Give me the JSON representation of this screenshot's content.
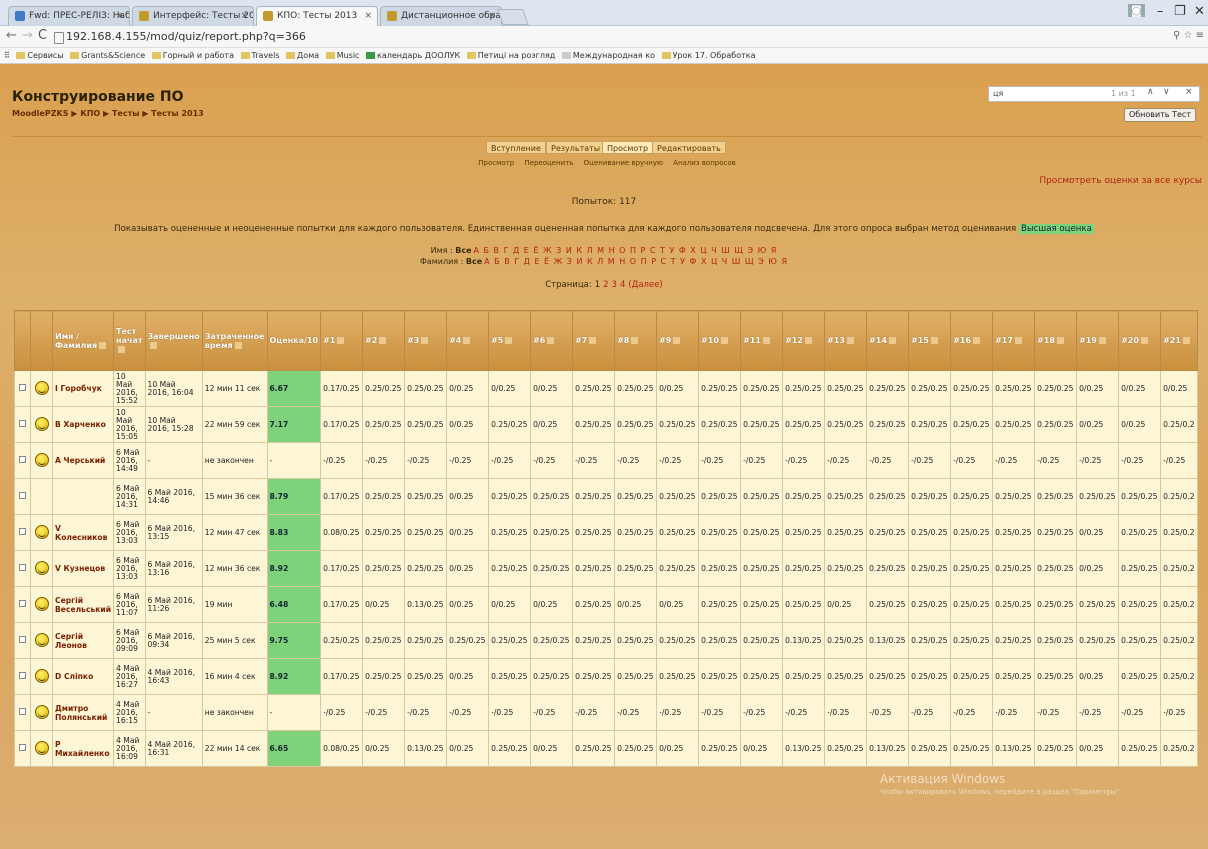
{
  "browser": {
    "tabs": [
      {
        "label": "Fwd: ПРЕС-РЕЛІЗ: Набо"
      },
      {
        "label": "Интерфейс: Тесты 2013"
      },
      {
        "label": "КПО: Тесты 2013"
      },
      {
        "label": "Дистанционное образо"
      }
    ],
    "url": "192.168.4.155/mod/quiz/report.php?q=366",
    "bookmarks": [
      "Сервисы",
      "Grants&Science",
      "Горный и работа",
      "Travels",
      "Дома",
      "Music",
      "календарь ДООЛУК",
      "Петиці на розгляд",
      "Международная ко",
      "Урок 17. Обработка"
    ]
  },
  "find": {
    "query": "ця",
    "count": "1 из 1"
  },
  "course": {
    "title": "Конструирование ПО",
    "breadcrumb": "MoodlePZKS ▶ КПО ▶ Тесты ▶ Тесты 2013",
    "refresh_label": "Обновить Тест"
  },
  "tabs": {
    "main": [
      "Вступление",
      "Результаты",
      "Просмотр",
      "Редактировать"
    ],
    "sub": [
      "Просмотр",
      "Переоценить",
      "Оценивание вручную",
      "Анализ вопросов"
    ]
  },
  "report": {
    "all_grades_link": "Просмотреть оценки за все курсы",
    "attempts": "Попыток: 117",
    "description": "Показывать оцененные и неоцененные попытки для каждого пользователя. Единственная оцененная попытка для каждого пользователя подсвечена. Для этого опроса выбран метод оценивания",
    "method": "Высшая оценка",
    "firstname_label": "Имя :",
    "lastname_label": "Фамилия :",
    "all_label": "Все",
    "letters": "А Б В Г Д Е Ё Ж З И К Л М Н О П Р С Т У Ф Х Ц Ч Ш Щ Э Ю Я",
    "pages_label": "Страница:",
    "pages": [
      "1",
      "2",
      "3",
      "4",
      "(Далее)"
    ]
  },
  "columns": [
    "",
    "",
    "Имя / Фамилия",
    "Тест начат",
    "Завершено",
    "Затраченное время",
    "Оценка/10",
    "#1",
    "#2",
    "#3",
    "#4",
    "#5",
    "#6",
    "#7",
    "#8",
    "#9",
    "#10",
    "#11",
    "#12",
    "#13",
    "#14",
    "#15",
    "#16",
    "#17",
    "#18",
    "#19",
    "#20",
    "#21"
  ],
  "rows": [
    {
      "name": "І Горобчук",
      "started": "10 Май 2016, 15:52",
      "finished": "10 Май 2016, 16:04",
      "time": "12 мин 11 сек",
      "grade": "6.67",
      "q": [
        "0.17/0.25",
        "0.25/0.25",
        "0.25/0.25",
        "0/0.25",
        "0/0.25",
        "0/0.25",
        "0.25/0.25",
        "0.25/0.25",
        "0/0.25",
        "0.25/0.25",
        "0.25/0.25",
        "0.25/0.25",
        "0.25/0.25",
        "0.25/0.25",
        "0.25/0.25",
        "0.25/0.25",
        "0.25/0.25",
        "0.25/0.25",
        "0/0.25",
        "0/0.25",
        "0/0.25"
      ]
    },
    {
      "name": "В Харченко",
      "started": "10 Май 2016, 15:05",
      "finished": "10 Май 2016, 15:28",
      "time": "22 мин 59 сек",
      "grade": "7.17",
      "q": [
        "0.17/0.25",
        "0.25/0.25",
        "0.25/0.25",
        "0/0.25",
        "0.25/0.25",
        "0/0.25",
        "0.25/0.25",
        "0.25/0.25",
        "0.25/0.25",
        "0.25/0.25",
        "0.25/0.25",
        "0.25/0.25",
        "0.25/0.25",
        "0.25/0.25",
        "0.25/0.25",
        "0.25/0.25",
        "0.25/0.25",
        "0.25/0.25",
        "0/0.25",
        "0/0.25",
        "0.25/0.2"
      ]
    },
    {
      "name": "А Черський",
      "started": "6 Май 2016, 14:49",
      "finished": "-",
      "time": "не закончен",
      "grade": "-",
      "q": [
        "-/0.25",
        "-/0.25",
        "-/0.25",
        "-/0.25",
        "-/0.25",
        "-/0.25",
        "-/0.25",
        "-/0.25",
        "-/0.25",
        "-/0.25",
        "-/0.25",
        "-/0.25",
        "-/0.25",
        "-/0.25",
        "-/0.25",
        "-/0.25",
        "-/0.25",
        "-/0.25",
        "-/0.25",
        "-/0.25",
        "-/0.25"
      ]
    },
    {
      "name": "",
      "started": "6 Май 2016, 14:31",
      "finished": "6 Май 2016, 14:46",
      "time": "15 мин 36 сек",
      "grade": "8.79",
      "q": [
        "0.17/0.25",
        "0.25/0.25",
        "0.25/0.25",
        "0/0.25",
        "0.25/0.25",
        "0.25/0.25",
        "0.25/0.25",
        "0.25/0.25",
        "0.25/0.25",
        "0.25/0.25",
        "0.25/0.25",
        "0.25/0.25",
        "0.25/0.25",
        "0.25/0.25",
        "0.25/0.25",
        "0.25/0.25",
        "0.25/0.25",
        "0.25/0.25",
        "0.25/0.25",
        "0.25/0.25",
        "0.25/0.2"
      ]
    },
    {
      "name": "V Колесников",
      "started": "6 Май 2016, 13:03",
      "finished": "6 Май 2016, 13:15",
      "time": "12 мин 47 сек",
      "grade": "8.83",
      "q": [
        "0.08/0.25",
        "0.25/0.25",
        "0.25/0.25",
        "0/0.25",
        "0.25/0.25",
        "0.25/0.25",
        "0.25/0.25",
        "0.25/0.25",
        "0.25/0.25",
        "0.25/0.25",
        "0.25/0.25",
        "0.25/0.25",
        "0.25/0.25",
        "0.25/0.25",
        "0.25/0.25",
        "0.25/0.25",
        "0.25/0.25",
        "0.25/0.25",
        "0/0.25",
        "0.25/0.25",
        "0.25/0.2"
      ]
    },
    {
      "name": "V Кузнецов",
      "started": "6 Май 2016, 13:03",
      "finished": "6 Май 2016, 13:16",
      "time": "12 мин 36 сек",
      "grade": "8.92",
      "q": [
        "0.17/0.25",
        "0.25/0.25",
        "0.25/0.25",
        "0/0.25",
        "0.25/0.25",
        "0.25/0.25",
        "0.25/0.25",
        "0.25/0.25",
        "0.25/0.25",
        "0.25/0.25",
        "0.25/0.25",
        "0.25/0.25",
        "0.25/0.25",
        "0.25/0.25",
        "0.25/0.25",
        "0.25/0.25",
        "0.25/0.25",
        "0.25/0.25",
        "0/0.25",
        "0.25/0.25",
        "0.25/0.2"
      ]
    },
    {
      "name": "Сергій Весельський",
      "started": "6 Май 2016, 11:07",
      "finished": "6 Май 2016, 11:26",
      "time": "19 мин",
      "grade": "6.48",
      "q": [
        "0.17/0.25",
        "0/0.25",
        "0.13/0.25",
        "0/0.25",
        "0/0.25",
        "0/0.25",
        "0.25/0.25",
        "0/0.25",
        "0/0.25",
        "0.25/0.25",
        "0.25/0.25",
        "0.25/0.25",
        "0/0.25",
        "0.25/0.25",
        "0.25/0.25",
        "0.25/0.25",
        "0.25/0.25",
        "0.25/0.25",
        "0.25/0.25",
        "0.25/0.25",
        "0.25/0.2"
      ]
    },
    {
      "name": "Сергій Леонов",
      "started": "6 Май 2016, 09:09",
      "finished": "6 Май 2016, 09:34",
      "time": "25 мин 5 сек",
      "grade": "9.75",
      "q": [
        "0.25/0.25",
        "0.25/0.25",
        "0.25/0.25",
        "0.25/0.25",
        "0.25/0.25",
        "0.25/0.25",
        "0.25/0.25",
        "0.25/0.25",
        "0.25/0.25",
        "0.25/0.25",
        "0.25/0.25",
        "0.13/0.25",
        "0.25/0.25",
        "0.13/0.25",
        "0.25/0.25",
        "0.25/0.25",
        "0.25/0.25",
        "0.25/0.25",
        "0.25/0.25",
        "0.25/0.25",
        "0.25/0.2"
      ]
    },
    {
      "name": "D Сліпко",
      "started": "4 Май 2016, 16:27",
      "finished": "4 Май 2016, 16:43",
      "time": "16 мин 4 сек",
      "grade": "8.92",
      "q": [
        "0.17/0.25",
        "0.25/0.25",
        "0.25/0.25",
        "0/0.25",
        "0.25/0.25",
        "0.25/0.25",
        "0.25/0.25",
        "0.25/0.25",
        "0.25/0.25",
        "0.25/0.25",
        "0.25/0.25",
        "0.25/0.25",
        "0.25/0.25",
        "0.25/0.25",
        "0.25/0.25",
        "0.25/0.25",
        "0.25/0.25",
        "0.25/0.25",
        "0/0.25",
        "0.25/0.25",
        "0.25/0.2"
      ]
    },
    {
      "name": "Дмитро Полянський",
      "started": "4 Май 2016, 16:15",
      "finished": "-",
      "time": "не закончен",
      "grade": "-",
      "q": [
        "-/0.25",
        "-/0.25",
        "-/0.25",
        "-/0.25",
        "-/0.25",
        "-/0.25",
        "-/0.25",
        "-/0.25",
        "-/0.25",
        "-/0.25",
        "-/0.25",
        "-/0.25",
        "-/0.25",
        "-/0.25",
        "-/0.25",
        "-/0.25",
        "-/0.25",
        "-/0.25",
        "-/0.25",
        "-/0.25",
        "-/0.25"
      ]
    },
    {
      "name": "Р Михайленко",
      "started": "4 Май 2016, 16:09",
      "finished": "4 Май 2016, 16:31",
      "time": "22 мин 14 сек",
      "grade": "6.65",
      "q": [
        "0.08/0.25",
        "0/0.25",
        "0.13/0.25",
        "0/0.25",
        "0.25/0.25",
        "0/0.25",
        "0.25/0.25",
        "0.25/0.25",
        "0/0.25",
        "0.25/0.25",
        "0/0.25",
        "0.13/0.25",
        "0.25/0.25",
        "0.13/0.25",
        "0.25/0.25",
        "0.25/0.25",
        "0.13/0.25",
        "0.25/0.25",
        "0/0.25",
        "0.25/0.25",
        "0.25/0.2"
      ]
    }
  ],
  "watermark": {
    "line1": "Активация Windows",
    "line2": "Чтобы активировать Windows, перейдите в раздел \"Параметры\"."
  }
}
